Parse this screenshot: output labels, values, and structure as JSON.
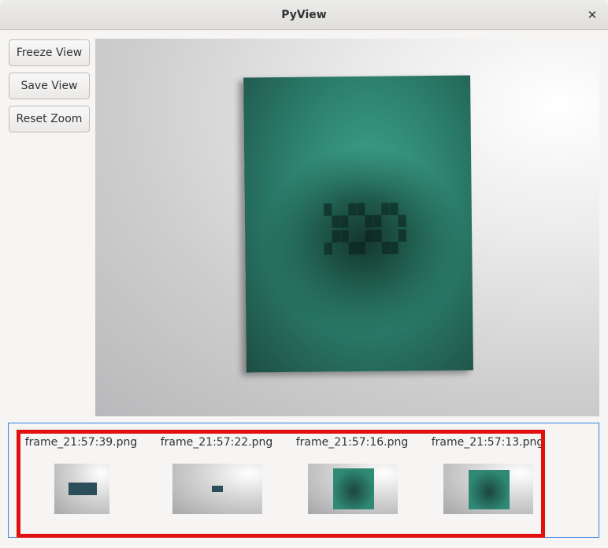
{
  "window": {
    "title": "PyView"
  },
  "toolbar": {
    "freeze_label": "Freeze View",
    "save_label": "Save View",
    "reset_label": "Reset Zoom"
  },
  "saved_frames": [
    {
      "name": "frame_21:57:39.png"
    },
    {
      "name": "frame_21:57:22.png"
    },
    {
      "name": "frame_21:57:16.png"
    },
    {
      "name": "frame_21:57:13.png"
    }
  ],
  "colors": {
    "highlight": "#e0100f",
    "strip_border": "#3584e4",
    "book": "#2b7d6b"
  },
  "icons": {
    "close": "close-icon"
  }
}
